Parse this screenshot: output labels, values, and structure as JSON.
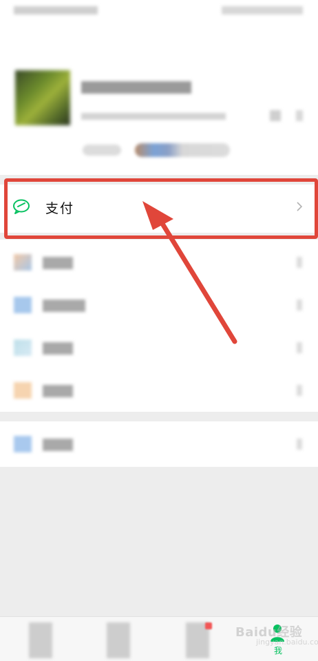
{
  "menu": {
    "pay": {
      "label": "支付"
    }
  },
  "tabbar": {
    "me_label": "我"
  },
  "watermark": {
    "brand": "Baidu经验",
    "sub": "jingyan.baidu.com"
  },
  "colors": {
    "highlight": "#e0463a",
    "accent_green": "#07c160"
  },
  "icons": {
    "pay": "wechat-pay-icon",
    "chevron": "chevron-right-icon"
  }
}
